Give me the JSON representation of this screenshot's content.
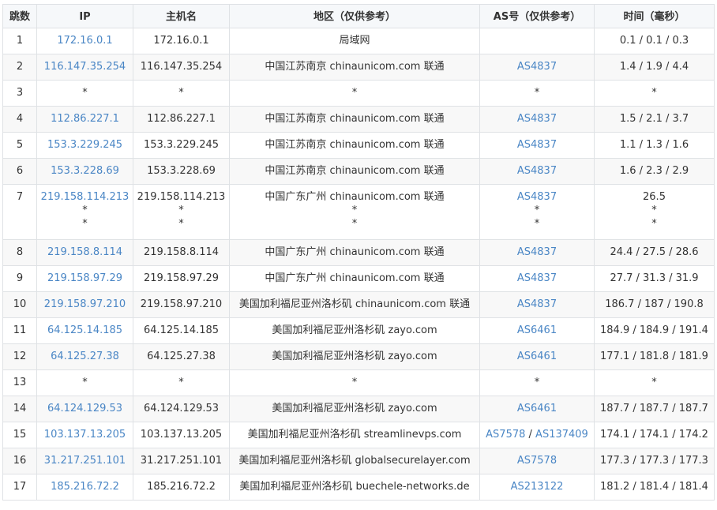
{
  "columns": [
    "跳数",
    "IP",
    "主机名",
    "地区（仅供参考）",
    "AS号（仅供参考）",
    "时间（毫秒）"
  ],
  "rows": [
    {
      "hop": "1",
      "ip": [
        "172.16.0.1"
      ],
      "host": [
        "172.16.0.1"
      ],
      "region": [
        "局域网"
      ],
      "as": [
        []
      ],
      "time": [
        "0.1 / 0.1 / 0.3"
      ]
    },
    {
      "hop": "2",
      "ip": [
        "116.147.35.254"
      ],
      "host": [
        "116.147.35.254"
      ],
      "region": [
        "中国江苏南京 chinaunicom.com 联通"
      ],
      "as": [
        [
          "AS4837"
        ]
      ],
      "time": [
        "1.4 / 1.9 / 4.4"
      ]
    },
    {
      "hop": "3",
      "ip": [
        "*"
      ],
      "host": [
        "*"
      ],
      "region": [
        "*"
      ],
      "as": [
        [
          "*"
        ]
      ],
      "time": [
        "*"
      ]
    },
    {
      "hop": "4",
      "ip": [
        "112.86.227.1"
      ],
      "host": [
        "112.86.227.1"
      ],
      "region": [
        "中国江苏南京 chinaunicom.com 联通"
      ],
      "as": [
        [
          "AS4837"
        ]
      ],
      "time": [
        "1.5 / 2.1 / 3.7"
      ]
    },
    {
      "hop": "5",
      "ip": [
        "153.3.229.245"
      ],
      "host": [
        "153.3.229.245"
      ],
      "region": [
        "中国江苏南京 chinaunicom.com 联通"
      ],
      "as": [
        [
          "AS4837"
        ]
      ],
      "time": [
        "1.1 / 1.3 / 1.6"
      ]
    },
    {
      "hop": "6",
      "ip": [
        "153.3.228.69"
      ],
      "host": [
        "153.3.228.69"
      ],
      "region": [
        "中国江苏南京 chinaunicom.com 联通"
      ],
      "as": [
        [
          "AS4837"
        ]
      ],
      "time": [
        "1.6 / 2.3 / 2.9"
      ]
    },
    {
      "hop": "7",
      "ip": [
        "219.158.114.213",
        "*",
        "*"
      ],
      "host": [
        "219.158.114.213",
        "*",
        "*"
      ],
      "region": [
        "中国广东广州 chinaunicom.com 联通",
        "*",
        "*"
      ],
      "as": [
        [
          "AS4837"
        ],
        [
          "*"
        ],
        [
          "*"
        ]
      ],
      "time": [
        "26.5",
        "*",
        "*"
      ]
    },
    {
      "hop": "8",
      "ip": [
        "219.158.8.114"
      ],
      "host": [
        "219.158.8.114"
      ],
      "region": [
        "中国广东广州 chinaunicom.com 联通"
      ],
      "as": [
        [
          "AS4837"
        ]
      ],
      "time": [
        "24.4 / 27.5 / 28.6"
      ]
    },
    {
      "hop": "9",
      "ip": [
        "219.158.97.29"
      ],
      "host": [
        "219.158.97.29"
      ],
      "region": [
        "中国广东广州 chinaunicom.com 联通"
      ],
      "as": [
        [
          "AS4837"
        ]
      ],
      "time": [
        "27.7 / 31.3 / 31.9"
      ]
    },
    {
      "hop": "10",
      "ip": [
        "219.158.97.210"
      ],
      "host": [
        "219.158.97.210"
      ],
      "region": [
        "美国加利福尼亚州洛杉矶 chinaunicom.com 联通"
      ],
      "as": [
        [
          "AS4837"
        ]
      ],
      "time": [
        "186.7 / 187 / 190.8"
      ]
    },
    {
      "hop": "11",
      "ip": [
        "64.125.14.185"
      ],
      "host": [
        "64.125.14.185"
      ],
      "region": [
        "美国加利福尼亚州洛杉矶 zayo.com"
      ],
      "as": [
        [
          "AS6461"
        ]
      ],
      "time": [
        "184.9 / 184.9 / 191.4"
      ]
    },
    {
      "hop": "12",
      "ip": [
        "64.125.27.38"
      ],
      "host": [
        "64.125.27.38"
      ],
      "region": [
        "美国加利福尼亚州洛杉矶 zayo.com"
      ],
      "as": [
        [
          "AS6461"
        ]
      ],
      "time": [
        "177.1 / 181.8 / 181.9"
      ]
    },
    {
      "hop": "13",
      "ip": [
        "*"
      ],
      "host": [
        "*"
      ],
      "region": [
        "*"
      ],
      "as": [
        [
          "*"
        ]
      ],
      "time": [
        "*"
      ]
    },
    {
      "hop": "14",
      "ip": [
        "64.124.129.53"
      ],
      "host": [
        "64.124.129.53"
      ],
      "region": [
        "美国加利福尼亚州洛杉矶 zayo.com"
      ],
      "as": [
        [
          "AS6461"
        ]
      ],
      "time": [
        "187.7 / 187.7 / 187.7"
      ]
    },
    {
      "hop": "15",
      "ip": [
        "103.137.13.205"
      ],
      "host": [
        "103.137.13.205"
      ],
      "region": [
        "美国加利福尼亚州洛杉矶 streamlinevps.com"
      ],
      "as": [
        [
          "AS7578",
          "AS137409"
        ]
      ],
      "time": [
        "174.1 / 174.1 / 174.2"
      ]
    },
    {
      "hop": "16",
      "ip": [
        "31.217.251.101"
      ],
      "host": [
        "31.217.251.101"
      ],
      "region": [
        "美国加利福尼亚州洛杉矶 globalsecurelayer.com"
      ],
      "as": [
        [
          "AS7578"
        ]
      ],
      "time": [
        "177.3 / 177.3 / 177.3"
      ]
    },
    {
      "hop": "17",
      "ip": [
        "185.216.72.2"
      ],
      "host": [
        "185.216.72.2"
      ],
      "region": [
        "美国加利福尼亚州洛杉矶 buechele-networks.de"
      ],
      "as": [
        [
          "AS213122"
        ]
      ],
      "time": [
        "181.2 / 181.4 / 181.4"
      ]
    }
  ],
  "colors": {
    "link": "#4a86c5",
    "text": "#333333",
    "border": "#dfe2e5",
    "header_bg": "#f6f8fa",
    "stripe_bg": "#f8f8f8"
  }
}
